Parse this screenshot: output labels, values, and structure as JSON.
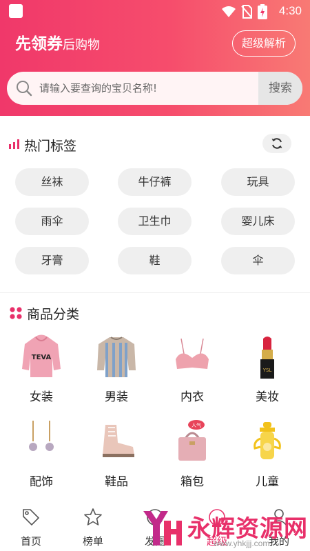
{
  "status_bar": {
    "time": "4:30"
  },
  "header": {
    "title_main": "先领券",
    "title_sub": "后购物",
    "parse_button": "超级解析"
  },
  "search": {
    "placeholder": "请输入要查询的宝贝名称!",
    "button": "搜索"
  },
  "hot_tags": {
    "title": "热门标签",
    "items": [
      "丝袜",
      "牛仔裤",
      "玩具",
      "雨伞",
      "卫生巾",
      "婴儿床",
      "牙膏",
      "鞋",
      "伞"
    ]
  },
  "categories": {
    "title": "商品分类",
    "items": [
      {
        "label": "女装",
        "icon": "pink-hoodie"
      },
      {
        "label": "男装",
        "icon": "striped-sweater"
      },
      {
        "label": "内衣",
        "icon": "bra"
      },
      {
        "label": "美妆",
        "icon": "lipstick"
      },
      {
        "label": "配饰",
        "icon": "pearl-earrings"
      },
      {
        "label": "鞋品",
        "icon": "boots"
      },
      {
        "label": "箱包",
        "icon": "pink-handbag"
      },
      {
        "label": "儿童",
        "icon": "sippy-cup"
      }
    ]
  },
  "bottom_nav": [
    {
      "label": "首页",
      "icon": "tag-icon"
    },
    {
      "label": "榜单",
      "icon": "star-icon"
    },
    {
      "label": "发圈",
      "icon": "circle-icon"
    },
    {
      "label": "超级",
      "icon": "super-icon"
    },
    {
      "label": "我的",
      "icon": "user-icon"
    }
  ],
  "watermark": {
    "text": "永辉资源网",
    "url": "www.yhkjjj.com"
  },
  "colors": {
    "accent": "#f0386a",
    "tag_bg": "#efefef"
  }
}
